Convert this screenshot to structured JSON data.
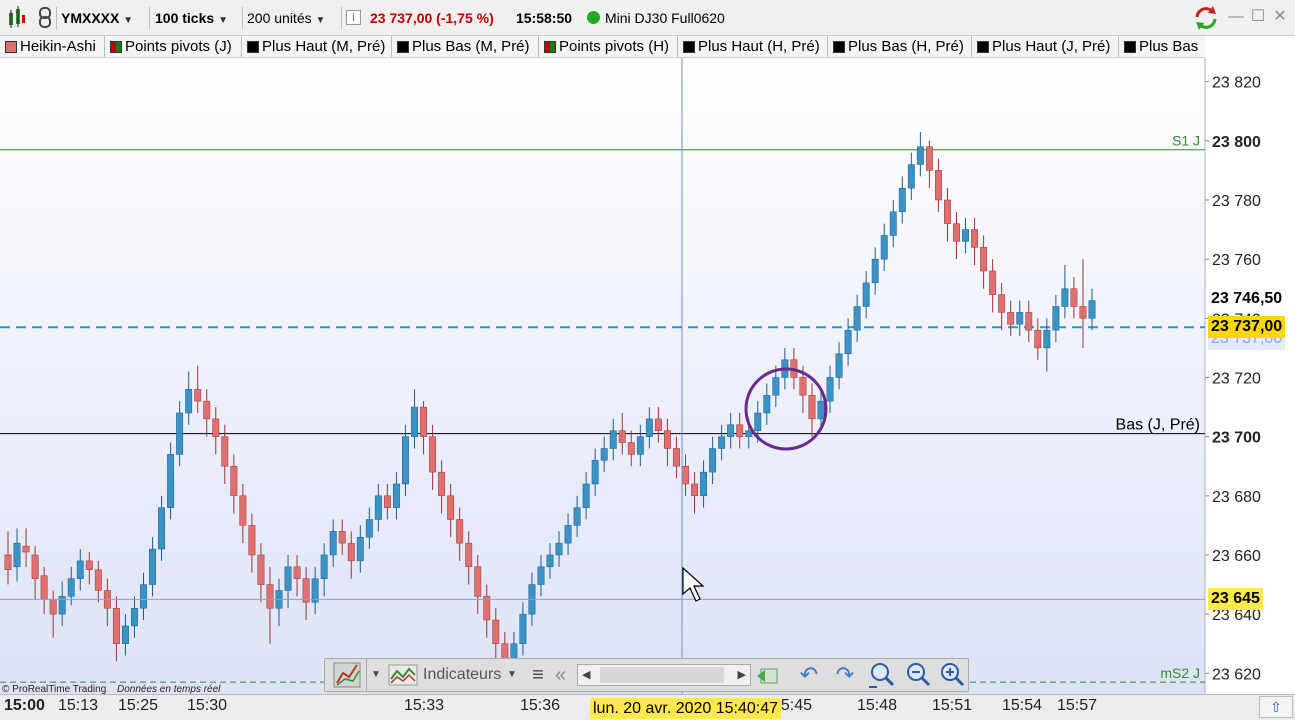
{
  "toolbar": {
    "symbol": "YMXXXX",
    "ticks": "100 ticks",
    "units": "200 unités",
    "info_icon": "i",
    "price_change": "23 737,00 (-1,75 %)",
    "time": "15:58:50",
    "instrument": "Mini DJ30 Full0620",
    "colors": {
      "negative": "#c00000",
      "connected": "#22aa22"
    }
  },
  "tabs": [
    {
      "label": "Heikin-Ashi",
      "color": "#e07070"
    },
    {
      "label": "Points pivots (J)",
      "color": "split-red-green"
    },
    {
      "label": "Plus Haut (M, Pré)",
      "color": "#000000"
    },
    {
      "label": "Plus Bas (M, Pré)",
      "color": "#000000"
    },
    {
      "label": "Points pivots (H)",
      "color": "split-red-green"
    },
    {
      "label": "Plus Haut (H, Pré)",
      "color": "#000000"
    },
    {
      "label": "Plus Bas (H, Pré)",
      "color": "#000000"
    },
    {
      "label": "Plus Haut (J, Pré)",
      "color": "#000000"
    },
    {
      "label": "Plus Bas",
      "color": "#000000"
    }
  ],
  "chart_data": {
    "type": "candlestick",
    "style": "Heikin-Ashi",
    "y_axis_labels": [
      "23 820",
      "23 800",
      "23 780",
      "23 760",
      "23 740",
      "23 720",
      "23 700",
      "23 680",
      "23 660",
      "23 640",
      "23 620"
    ],
    "ylim": [
      23613,
      23828
    ],
    "x_axis_labels": [
      "15:00",
      "15:13",
      "15:25",
      "15:30",
      "15:33",
      "15:36",
      "15:45",
      "15:48",
      "15:51",
      "15:54",
      "15:57"
    ],
    "cursor_time_label": "lun. 20 avr. 2020 15:40:47",
    "lines": [
      {
        "label": "S1 J",
        "value": 23797,
        "color": "#2e8b2e",
        "style": "solid"
      },
      {
        "label": "Bas (J, Pré)",
        "value": 23701,
        "color": "#000000",
        "style": "solid"
      },
      {
        "label": "mS2 J",
        "value": 23617,
        "color": "#2e8b2e",
        "style": "dashed"
      },
      {
        "label": "",
        "value": 23737,
        "color": "#1e9fc0",
        "style": "dashed"
      }
    ],
    "price_tags": [
      {
        "text": "23 746,50",
        "value": 23746.5,
        "bg": "#ffffff",
        "fg": "#000000"
      },
      {
        "text": "23 737,00",
        "value": 23737,
        "bg": "#ffd700",
        "fg": "#000000"
      },
      {
        "text": "23 737,00",
        "value": 23733,
        "bg": "#e0ecf8",
        "fg": "#8aaecc"
      },
      {
        "text": "23 645",
        "value": 23645,
        "bg": "#ffe84a",
        "fg": "#000000"
      }
    ],
    "candles": [
      [
        23660,
        23655,
        23668,
        23650
      ],
      [
        23656,
        23664,
        23669,
        23651
      ],
      [
        23663,
        23661,
        23669,
        23656
      ],
      [
        23660,
        23652,
        23663,
        23645
      ],
      [
        23653,
        23645,
        23656,
        23640
      ],
      [
        23645,
        23640,
        23648,
        23632
      ],
      [
        23640,
        23646,
        23651,
        23636
      ],
      [
        23646,
        23652,
        23656,
        23643
      ],
      [
        23652,
        23658,
        23662,
        23648
      ],
      [
        23658,
        23655,
        23661,
        23650
      ],
      [
        23655,
        23648,
        23658,
        23644
      ],
      [
        23648,
        23642,
        23652,
        23636
      ],
      [
        23642,
        23630,
        23646,
        23624
      ],
      [
        23630,
        23636,
        23640,
        23626
      ],
      [
        23636,
        23642,
        23646,
        23632
      ],
      [
        23642,
        23650,
        23654,
        23638
      ],
      [
        23650,
        23662,
        23666,
        23646
      ],
      [
        23662,
        23676,
        23680,
        23658
      ],
      [
        23676,
        23694,
        23698,
        23672
      ],
      [
        23694,
        23708,
        23712,
        23690
      ],
      [
        23708,
        23716,
        23722,
        23704
      ],
      [
        23716,
        23712,
        23724,
        23708
      ],
      [
        23712,
        23706,
        23716,
        23700
      ],
      [
        23706,
        23700,
        23710,
        23694
      ],
      [
        23700,
        23690,
        23704,
        23684
      ],
      [
        23690,
        23680,
        23694,
        23674
      ],
      [
        23680,
        23670,
        23684,
        23664
      ],
      [
        23670,
        23660,
        23674,
        23654
      ],
      [
        23660,
        23650,
        23664,
        23644
      ],
      [
        23650,
        23642,
        23656,
        23630
      ],
      [
        23642,
        23648,
        23652,
        23636
      ],
      [
        23648,
        23656,
        23660,
        23642
      ],
      [
        23656,
        23652,
        23660,
        23646
      ],
      [
        23652,
        23644,
        23656,
        23638
      ],
      [
        23644,
        23652,
        23656,
        23640
      ],
      [
        23652,
        23660,
        23664,
        23646
      ],
      [
        23660,
        23668,
        23672,
        23656
      ],
      [
        23668,
        23664,
        23672,
        23660
      ],
      [
        23664,
        23658,
        23668,
        23652
      ],
      [
        23658,
        23666,
        23670,
        23654
      ],
      [
        23666,
        23672,
        23676,
        23662
      ],
      [
        23672,
        23680,
        23684,
        23668
      ],
      [
        23680,
        23676,
        23684,
        23672
      ],
      [
        23676,
        23684,
        23688,
        23672
      ],
      [
        23684,
        23700,
        23704,
        23680
      ],
      [
        23700,
        23710,
        23716,
        23696
      ],
      [
        23710,
        23700,
        23712,
        23694
      ],
      [
        23700,
        23688,
        23704,
        23682
      ],
      [
        23688,
        23680,
        23692,
        23674
      ],
      [
        23680,
        23672,
        23684,
        23666
      ],
      [
        23672,
        23664,
        23676,
        23658
      ],
      [
        23664,
        23656,
        23668,
        23650
      ],
      [
        23656,
        23646,
        23660,
        23640
      ],
      [
        23646,
        23638,
        23650,
        23632
      ],
      [
        23638,
        23630,
        23642,
        23624
      ],
      [
        23630,
        23622,
        23634,
        23615
      ],
      [
        23622,
        23630,
        23634,
        23616
      ],
      [
        23630,
        23640,
        23644,
        23626
      ],
      [
        23640,
        23650,
        23654,
        23636
      ],
      [
        23650,
        23656,
        23660,
        23646
      ],
      [
        23656,
        23660,
        23664,
        23652
      ],
      [
        23660,
        23664,
        23668,
        23656
      ],
      [
        23664,
        23670,
        23674,
        23660
      ],
      [
        23670,
        23676,
        23680,
        23666
      ],
      [
        23676,
        23684,
        23688,
        23672
      ],
      [
        23684,
        23692,
        23696,
        23680
      ],
      [
        23692,
        23696,
        23700,
        23688
      ],
      [
        23696,
        23702,
        23706,
        23692
      ],
      [
        23702,
        23698,
        23708,
        23694
      ],
      [
        23698,
        23694,
        23702,
        23690
      ],
      [
        23694,
        23700,
        23704,
        23690
      ],
      [
        23700,
        23706,
        23710,
        23696
      ],
      [
        23706,
        23702,
        23710,
        23698
      ],
      [
        23702,
        23696,
        23706,
        23690
      ],
      [
        23696,
        23690,
        23700,
        23686
      ],
      [
        23690,
        23684,
        23694,
        23680
      ],
      [
        23684,
        23680,
        23688,
        23674
      ],
      [
        23680,
        23688,
        23692,
        23676
      ],
      [
        23688,
        23696,
        23700,
        23684
      ],
      [
        23696,
        23700,
        23704,
        23692
      ],
      [
        23700,
        23704,
        23708,
        23696
      ],
      [
        23704,
        23700,
        23708,
        23696
      ],
      [
        23700,
        23702,
        23706,
        23696
      ],
      [
        23702,
        23708,
        23712,
        23698
      ],
      [
        23708,
        23714,
        23718,
        23704
      ],
      [
        23714,
        23720,
        23724,
        23710
      ],
      [
        23720,
        23726,
        23730,
        23716
      ],
      [
        23726,
        23720,
        23730,
        23716
      ],
      [
        23720,
        23714,
        23724,
        23708
      ],
      [
        23714,
        23706,
        23718,
        23700
      ],
      [
        23706,
        23712,
        23716,
        23702
      ],
      [
        23712,
        23720,
        23724,
        23708
      ],
      [
        23720,
        23728,
        23732,
        23716
      ],
      [
        23728,
        23736,
        23740,
        23724
      ],
      [
        23736,
        23744,
        23748,
        23732
      ],
      [
        23744,
        23752,
        23756,
        23740
      ],
      [
        23752,
        23760,
        23764,
        23748
      ],
      [
        23760,
        23768,
        23772,
        23756
      ],
      [
        23768,
        23776,
        23780,
        23764
      ],
      [
        23776,
        23784,
        23788,
        23772
      ],
      [
        23784,
        23792,
        23796,
        23780
      ],
      [
        23792,
        23798,
        23803,
        23788
      ],
      [
        23798,
        23790,
        23800,
        23784
      ],
      [
        23790,
        23780,
        23794,
        23776
      ],
      [
        23780,
        23772,
        23784,
        23766
      ],
      [
        23772,
        23766,
        23776,
        23760
      ],
      [
        23766,
        23770,
        23774,
        23762
      ],
      [
        23770,
        23764,
        23774,
        23758
      ],
      [
        23764,
        23756,
        23768,
        23750
      ],
      [
        23756,
        23748,
        23760,
        23742
      ],
      [
        23748,
        23742,
        23752,
        23736
      ],
      [
        23742,
        23738,
        23746,
        23734
      ],
      [
        23738,
        23742,
        23746,
        23734
      ],
      [
        23742,
        23736,
        23746,
        23732
      ],
      [
        23736,
        23730,
        23740,
        23726
      ],
      [
        23730,
        23736,
        23740,
        23722
      ],
      [
        23736,
        23744,
        23748,
        23732
      ],
      [
        23744,
        23750,
        23758,
        23740
      ],
      [
        23750,
        23744,
        23754,
        23740
      ],
      [
        23744,
        23740,
        23760,
        23730
      ],
      [
        23740,
        23746,
        23750,
        23736
      ]
    ]
  },
  "attribution": {
    "brand": "© ProRealTime Trading",
    "note": "Données en temps réel"
  },
  "navbar": {
    "indicators_label": "Indicateurs",
    "icons": [
      "draw-tools-icon",
      "indicators-icon",
      "menu-icon",
      "scroll-left-icon",
      "scroll-right-icon",
      "reset-icon",
      "undo-icon",
      "redo-icon",
      "zoom-auto-icon",
      "zoom-out-icon",
      "zoom-in-icon"
    ]
  },
  "scroll_to_top_icon": "arrow-up-icon"
}
